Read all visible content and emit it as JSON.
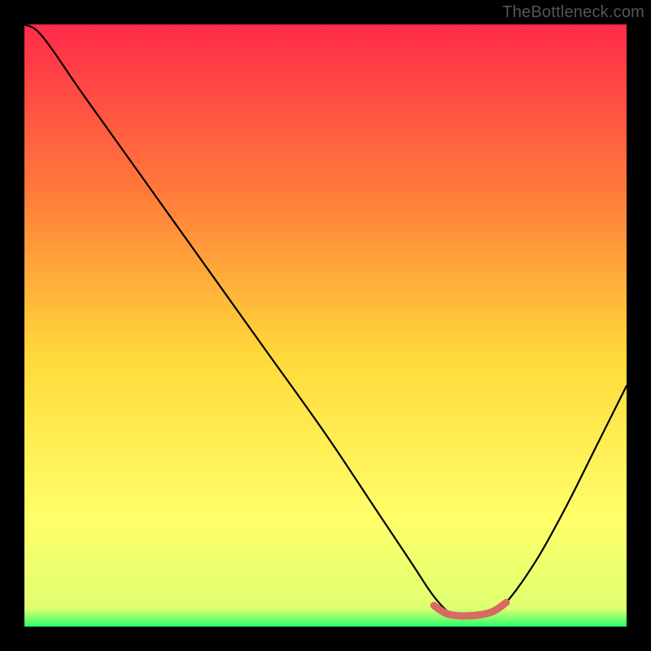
{
  "watermark": "TheBottleneck.com",
  "colors": {
    "page_bg": "#000000",
    "gradient_top": "#ff2a4a",
    "gradient_mid_upper": "#ff7b3a",
    "gradient_mid": "#ffd93a",
    "gradient_lower": "#ffff6a",
    "gradient_bottom": "#2aff6a",
    "curve": "#000000",
    "highlight": "#d86a63"
  },
  "chart_data": {
    "type": "line",
    "title": "",
    "xlabel": "",
    "ylabel": "",
    "xlim": [
      0,
      100
    ],
    "ylim": [
      0,
      100
    ],
    "description": "V-shaped bottleneck curve. Y is bottleneck percent (0 at bottom, 100 at top). X is relative component strength. Minimum near x≈72. Green band at y≤~4 indicates no bottleneck; salmon segment marks the flat optimum region.",
    "series": [
      {
        "name": "bottleneck-curve",
        "x": [
          0,
          3,
          10,
          20,
          30,
          40,
          50,
          58,
          64,
          68,
          71,
          73,
          77,
          80,
          85,
          90,
          95,
          100
        ],
        "values": [
          100,
          98,
          88,
          74,
          60,
          46,
          32,
          20,
          11,
          5,
          2,
          2,
          2,
          4,
          11,
          20,
          30,
          40
        ]
      },
      {
        "name": "optimum-region",
        "x": [
          68,
          70,
          72,
          74,
          76,
          78,
          80
        ],
        "values": [
          3.5,
          2.2,
          1.8,
          1.8,
          2.0,
          2.6,
          4.0
        ]
      }
    ]
  }
}
